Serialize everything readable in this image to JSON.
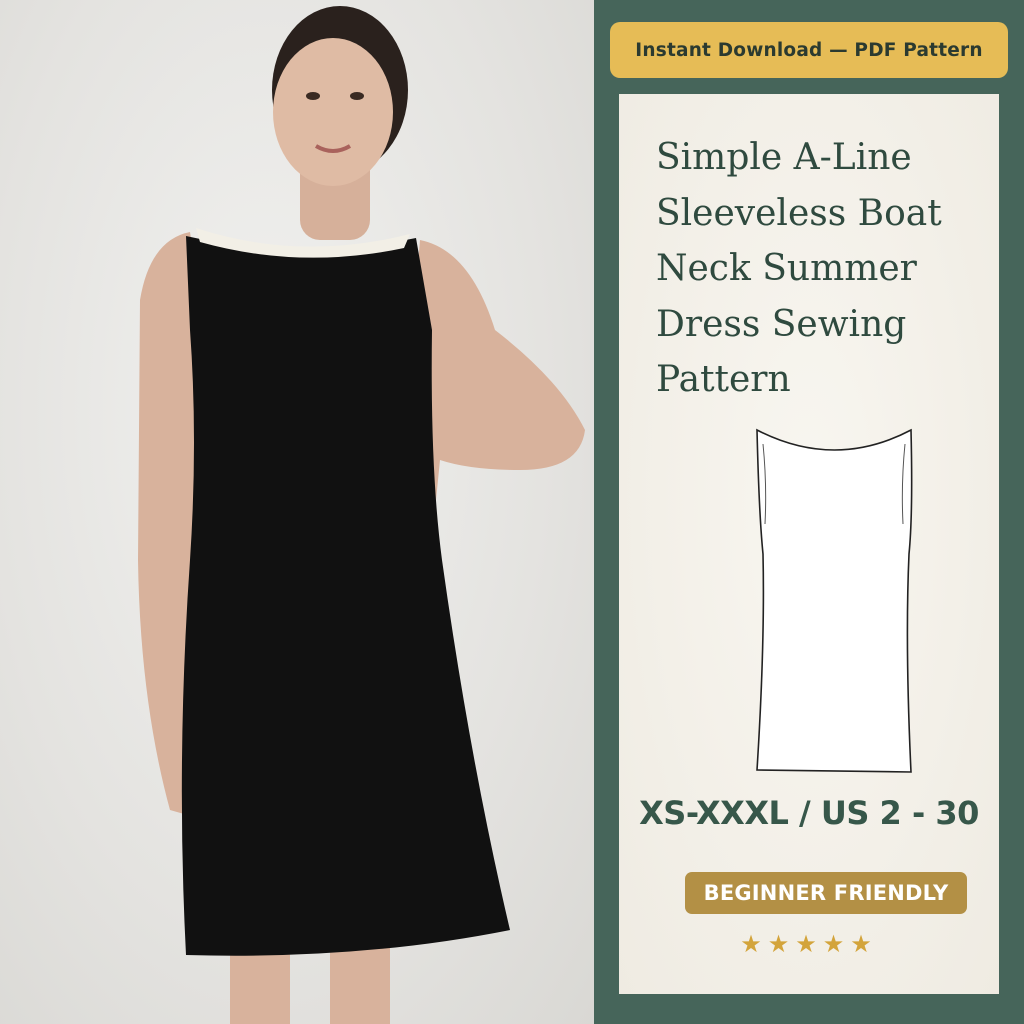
{
  "header_badge": "Instant Download — PDF Pattern",
  "title": "Simple A-Line Sleeveless Boat Neck Summer Dress Sewing Pattern",
  "sizes": "XS-XXXL / US 2 - 30",
  "level_badge": "BEGINNER FRIENDLY",
  "rating": {
    "stars": "★★★★★",
    "value": 5,
    "max": 5
  },
  "colors": {
    "panel_green": "#46655a",
    "badge_gold": "#e6bc56",
    "friendly_gold": "#b39045",
    "card_cream": "#f4f1ea",
    "title_green": "#2f4a3f",
    "dress_black": "#111111",
    "collar_white": "#f2efe6"
  },
  "photo": {
    "subject": "model wearing black sleeveless boat neck dress with white collar"
  },
  "illustration": {
    "subject": "dress-outline-icon"
  }
}
